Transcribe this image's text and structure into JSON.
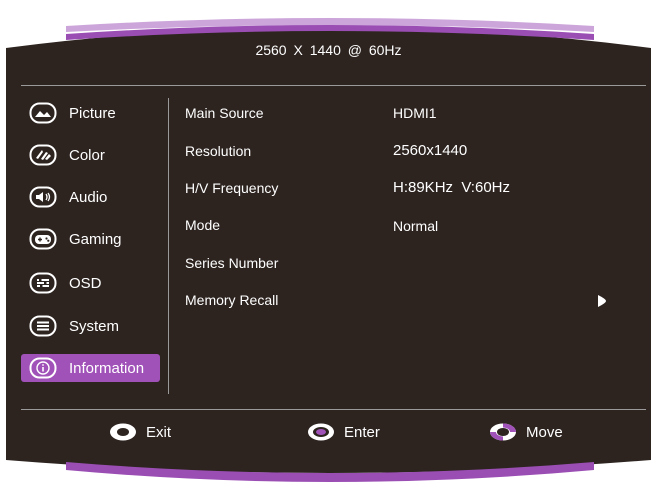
{
  "header": {
    "title": "2560  X  1440  @  60Hz"
  },
  "sidebar": {
    "items": [
      {
        "label": "Picture",
        "icon": "picture-icon",
        "active": false
      },
      {
        "label": "Color",
        "icon": "color-icon",
        "active": false
      },
      {
        "label": "Audio",
        "icon": "audio-icon",
        "active": false
      },
      {
        "label": "Gaming",
        "icon": "gaming-icon",
        "active": false
      },
      {
        "label": "OSD",
        "icon": "osd-icon",
        "active": false
      },
      {
        "label": "System",
        "icon": "system-icon",
        "active": false
      },
      {
        "label": "Information",
        "icon": "information-icon",
        "active": true
      }
    ]
  },
  "info": {
    "rows": [
      {
        "label": "Main Source",
        "value": "HDMI1"
      },
      {
        "label": "Resolution",
        "value": "2560x1440"
      },
      {
        "label": "H/V Frequency",
        "value": "H:89KHz  V:60Hz"
      },
      {
        "label": "Mode",
        "value": "Normal"
      },
      {
        "label": "Series Number",
        "value": ""
      },
      {
        "label": "Memory Recall",
        "value": ""
      }
    ],
    "memory_recall_arrow_icon": "arrow-right-icon"
  },
  "footer": {
    "exit_label": "Exit",
    "enter_label": "Enter",
    "move_label": "Move"
  },
  "colors": {
    "panel": "#2d2420",
    "accent": "#a052b8",
    "divider": "#9a9a9a",
    "text": "#ffffff"
  }
}
